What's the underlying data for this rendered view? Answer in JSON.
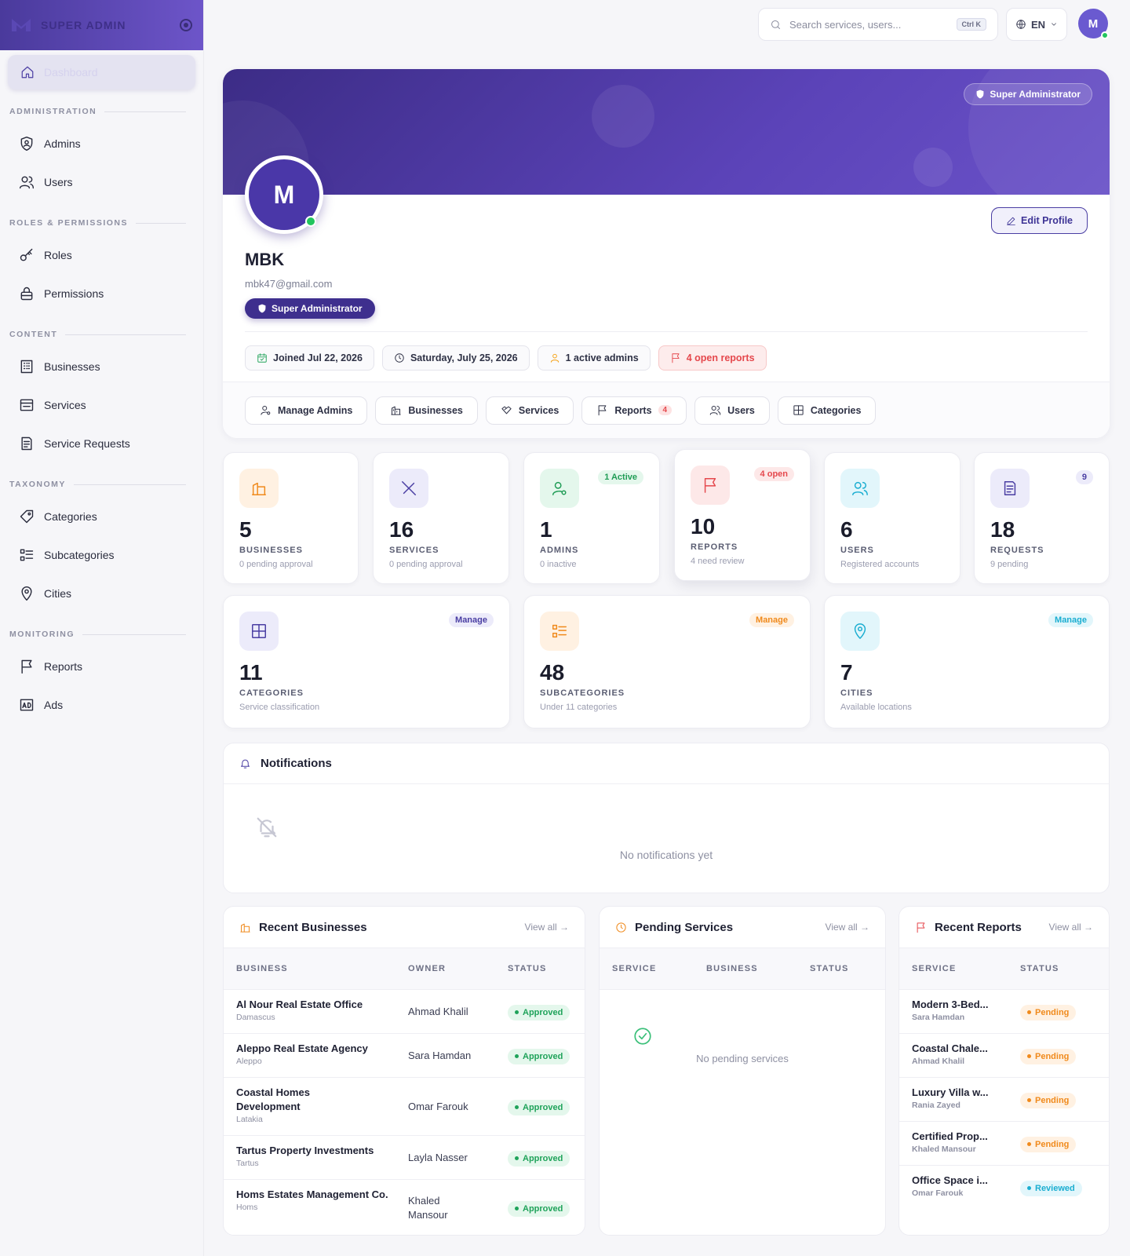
{
  "sidebar": {
    "brand": "SUPER ADMIN",
    "active": "Dashboard",
    "sections": [
      {
        "title": "ADMINISTRATION",
        "items": [
          "Admins",
          "Users"
        ]
      },
      {
        "title": "ROLES & PERMISSIONS",
        "items": [
          "Roles",
          "Permissions"
        ]
      },
      {
        "title": "CONTENT",
        "items": [
          "Businesses",
          "Services",
          "Service Requests"
        ]
      },
      {
        "title": "TAXONOMY",
        "items": [
          "Categories",
          "Subcategories",
          "Cities"
        ]
      },
      {
        "title": "MONITORING",
        "items": [
          "Reports",
          "Ads"
        ]
      }
    ]
  },
  "topbar": {
    "search_placeholder": "Search services, users...",
    "shortcut": "Ctrl K",
    "lang": "EN",
    "avatar": "M"
  },
  "profile": {
    "role_pill": "Super Administrator",
    "avatar": "M",
    "name": "MBK",
    "email": "mbk47@gmail.com",
    "role_badge": "Super Administrator",
    "edit": "Edit Profile",
    "chips": [
      "Joined Jul 22, 2026",
      "Saturday, July 25, 2026",
      "1 active admins",
      "4 open reports"
    ],
    "quick_links": [
      "Manage Admins",
      "Businesses",
      "Services",
      "Reports",
      "Users",
      "Categories"
    ],
    "reports_count": "4"
  },
  "stats": [
    {
      "num": "5",
      "label": "BUSINESSES",
      "sub": "0 pending approval",
      "tag": ""
    },
    {
      "num": "16",
      "label": "SERVICES",
      "sub": "0 pending approval",
      "tag": ""
    },
    {
      "num": "1",
      "label": "ADMINS",
      "sub": "0 inactive",
      "tag": "1 Active"
    },
    {
      "num": "10",
      "label": "REPORTS",
      "sub": "4 need review",
      "tag": "4 open"
    },
    {
      "num": "6",
      "label": "USERS",
      "sub": "Registered accounts",
      "tag": ""
    },
    {
      "num": "18",
      "label": "REQUESTS",
      "sub": "9 pending",
      "tag": "9"
    }
  ],
  "taxonomy": [
    {
      "num": "11",
      "label": "CATEGORIES",
      "sub": "Service classification",
      "tag": "Manage"
    },
    {
      "num": "48",
      "label": "SUBCATEGORIES",
      "sub": "Under 11 categories",
      "tag": "Manage"
    },
    {
      "num": "7",
      "label": "CITIES",
      "sub": "Available locations",
      "tag": "Manage"
    }
  ],
  "notifications": {
    "title": "Notifications",
    "empty": "No notifications yet"
  },
  "recent_businesses": {
    "title": "Recent Businesses",
    "view_all": "View all →",
    "columns": [
      "BUSINESS",
      "OWNER",
      "STATUS"
    ],
    "rows": [
      {
        "name": "Al Nour Real Estate Office",
        "city": "Damascus",
        "owner": "Ahmad Khalil",
        "status": "Approved"
      },
      {
        "name": "Aleppo Real Estate Agency",
        "city": "Aleppo",
        "owner": "Sara Hamdan",
        "status": "Approved"
      },
      {
        "name": "Coastal Homes Development",
        "city": "Latakia",
        "owner": "Omar Farouk",
        "status": "Approved"
      },
      {
        "name": "Tartus Property Investments",
        "city": "Tartus",
        "owner": "Layla Nasser",
        "status": "Approved"
      },
      {
        "name": "Homs Estates Management Co.",
        "city": "Homs",
        "owner": "Khaled Mansour",
        "status": "Approved"
      }
    ]
  },
  "pending_services": {
    "title": "Pending Services",
    "view_all": "View all →",
    "columns": [
      "SERVICE",
      "BUSINESS",
      "STATUS"
    ],
    "empty": "No pending services"
  },
  "recent_reports": {
    "title": "Recent Reports",
    "view_all": "View all →",
    "columns": [
      "SERVICE",
      "STATUS"
    ],
    "rows": [
      {
        "service": "Modern 3-Bed...",
        "user": "Sara Hamdan",
        "status": "Pending"
      },
      {
        "service": "Coastal Chale...",
        "user": "Ahmad Khalil",
        "status": "Pending"
      },
      {
        "service": "Luxury Villa w...",
        "user": "Rania Zayed",
        "status": "Pending"
      },
      {
        "service": "Certified Prop...",
        "user": "Khaled Mansour",
        "status": "Pending"
      },
      {
        "service": "Office Space i...",
        "user": "Omar Farouk",
        "status": "Reviewed"
      }
    ]
  },
  "colors": {
    "primary": "#4a3ea3",
    "banner": "#5b43b8",
    "success": "#22c55e",
    "danger": "#e5484d",
    "warning": "#f08a1c",
    "info": "#1baed1"
  }
}
